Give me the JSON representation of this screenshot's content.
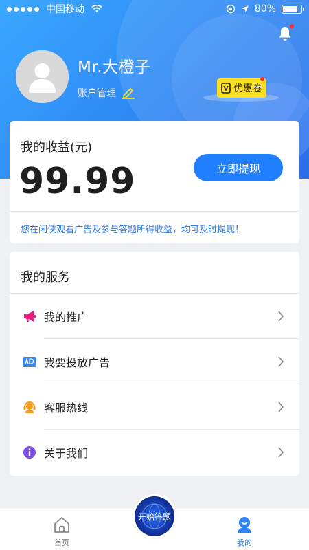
{
  "status_bar": {
    "carrier": "中国移动",
    "battery": "80%",
    "battery_level": 0.8
  },
  "profile": {
    "username": "Mr.大橙子",
    "account_link": "账户管理",
    "coupon": "优惠卷"
  },
  "earnings": {
    "title": "我的收益(元)",
    "amount": "99.99",
    "withdraw_label": "立即提现",
    "tip": "您在闲侠观看广告及参与答题所得收益，均可及时提现！"
  },
  "services": {
    "title": "我的服务",
    "items": [
      {
        "label": "我的推广",
        "icon": "megaphone-icon",
        "color": "#f0197d"
      },
      {
        "label": "我要投放广告",
        "icon": "ad-icon",
        "color": "#2f86f6"
      },
      {
        "label": "客服热线",
        "icon": "customer-service-icon",
        "color": "#f39a1c"
      },
      {
        "label": "关于我们",
        "icon": "info-icon",
        "color": "#7b4de0"
      }
    ]
  },
  "tabbar": {
    "home_label": "首页",
    "center_label": "开始答题",
    "mine_label": "我的"
  },
  "colors": {
    "accent": "#1f7fff",
    "header_start": "#3aa8ff",
    "header_end": "#2a6de6",
    "tip_text": "#2e7ef0"
  }
}
